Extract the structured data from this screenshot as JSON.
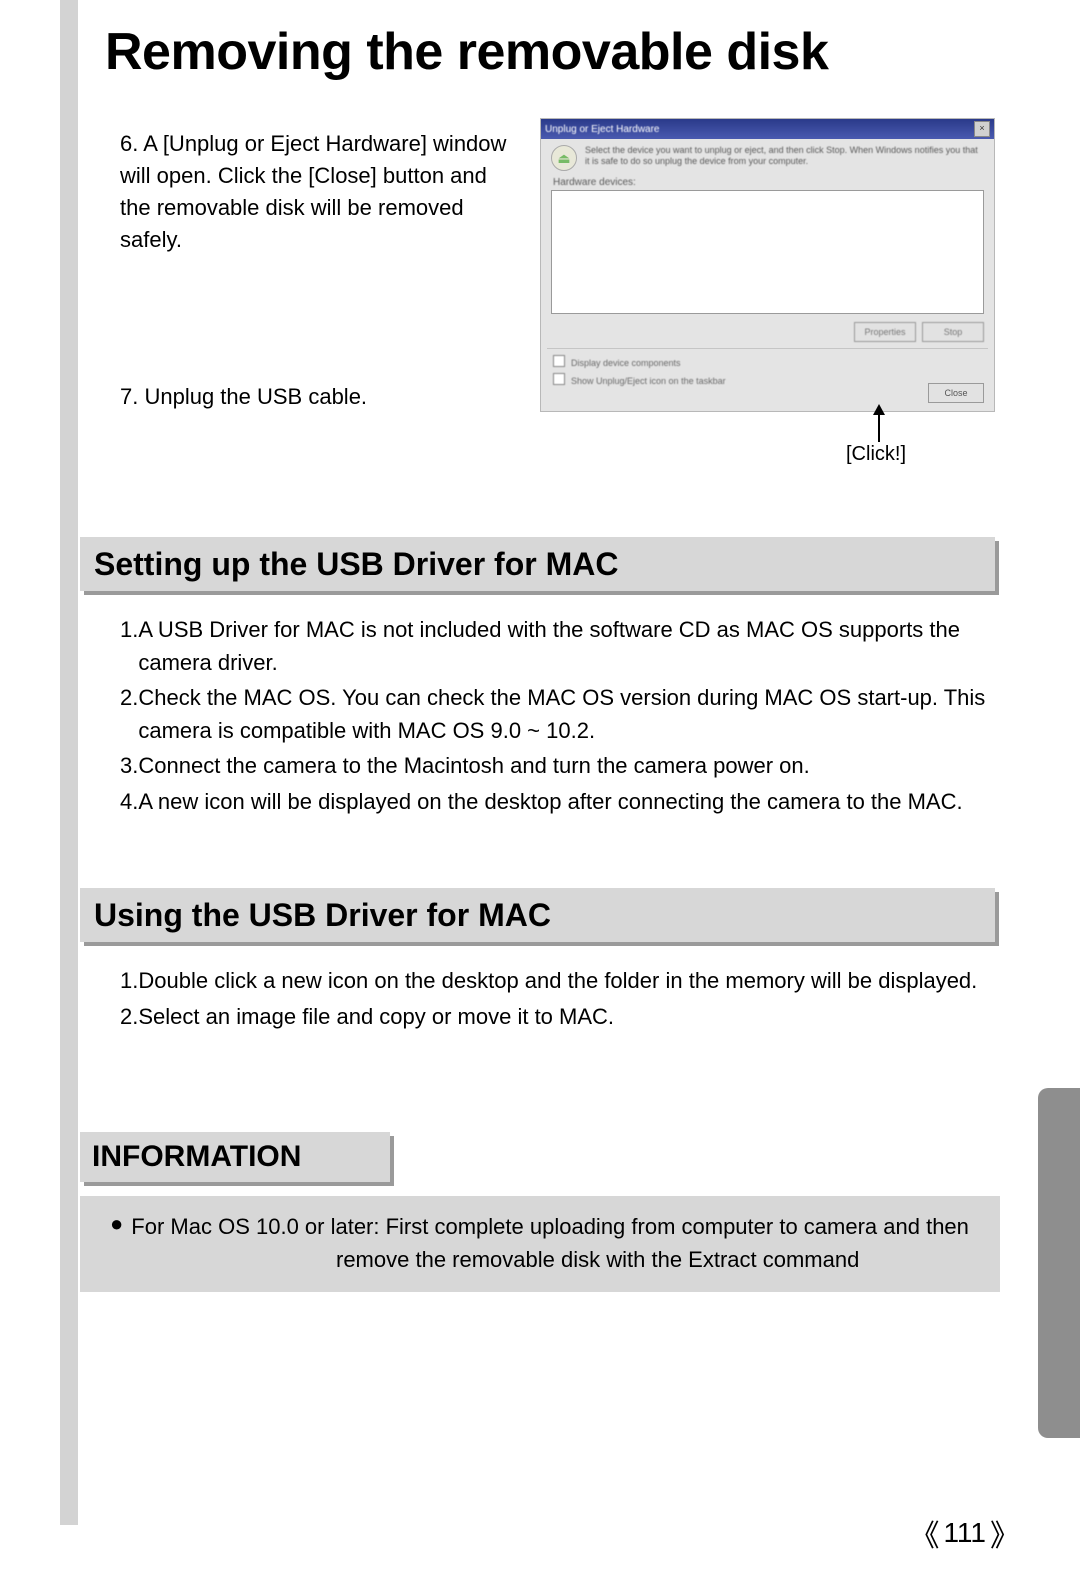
{
  "title": "Removing the removable disk",
  "steps": {
    "s6": "6. A [Unplug or Eject Hardware] window will open. Click the [Close] button and the removable disk will be removed safely.",
    "s7": "7. Unplug the USB cable."
  },
  "screenshot": {
    "title": "Unplug or Eject Hardware",
    "info": "Select the device you want to unplug or eject, and then click Stop. When Windows notifies you that it is safe to do so unplug the device from your computer.",
    "devices_label": "Hardware devices:",
    "btn_properties": "Properties",
    "btn_stop": "Stop",
    "chk1": "Display device components",
    "chk2": "Show Unplug/Eject icon on the taskbar",
    "btn_close": "Close"
  },
  "click_label": "[Click!]",
  "section1": {
    "title": "Setting up the USB Driver for MAC",
    "items": [
      {
        "n": "1. ",
        "t": "A USB Driver for MAC is not included with the software CD as MAC OS supports the camera driver."
      },
      {
        "n": "2. ",
        "t": "Check the MAC OS. You can check the MAC OS version during MAC OS start-up. This camera is compatible with MAC OS 9.0 ~ 10.2."
      },
      {
        "n": "3. ",
        "t": "Connect the camera to the Macintosh and turn the camera power on."
      },
      {
        "n": "4. ",
        "t": "A new icon will be displayed on the desktop after connecting the camera to the MAC."
      }
    ]
  },
  "section2": {
    "title": "Using the USB Driver for MAC",
    "items": [
      {
        "n": "1. ",
        "t": "Double click a new icon on the desktop and the folder in the memory will be displayed."
      },
      {
        "n": "2. ",
        "t": "Select an image file and copy or move it to MAC."
      }
    ]
  },
  "info": {
    "title": "INFORMATION",
    "line1": "For Mac OS 10.0 or later: First complete uploading from computer to camera and then",
    "line2": "remove the removable disk with the Extract command"
  },
  "page_number": "111"
}
